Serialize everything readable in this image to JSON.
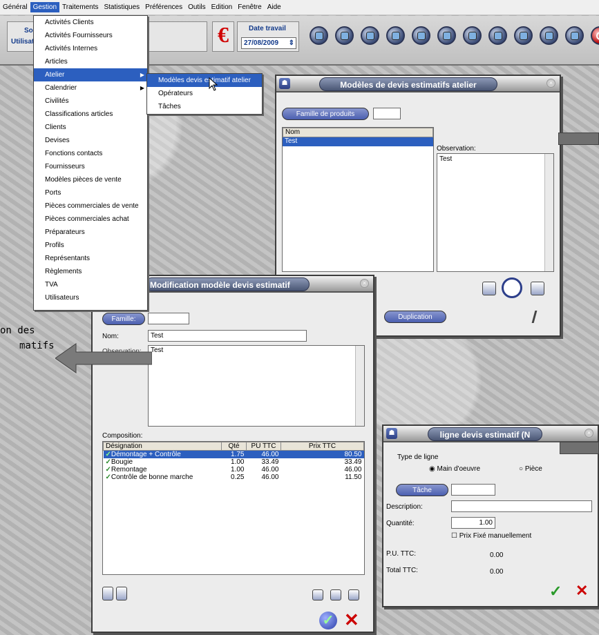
{
  "menubar": {
    "items": [
      "Général",
      "Gestion",
      "Traitements",
      "Statistiques",
      "Préférences",
      "Outils",
      "Edition",
      "Fenêtre",
      "Aide"
    ]
  },
  "toolbar": {
    "societe_label": "Socié",
    "utilisateur_label": "Utilisat",
    "euro": "€",
    "date_label": "Date travail",
    "date_value": "27/08/2009"
  },
  "gestion_menu": {
    "items": [
      "Activités Clients",
      "Activités Fournisseurs",
      "Activités Internes",
      "Articles",
      "Atelier",
      "Calendrier",
      "Civilités",
      "Classifications articles",
      "Clients",
      "Devises",
      "Fonctions contacts",
      "Fournisseurs",
      "Modèles pièces de vente",
      "Ports",
      "Pièces commerciales de vente",
      "Pièces commerciales achat",
      "Préparateurs",
      "Profils",
      "Représentants",
      "Règlements",
      "TVA",
      "Utilisateurs"
    ],
    "selected": "Atelier"
  },
  "atelier_submenu": {
    "items": [
      "Modèles devis estimatif atelier",
      "Opérateurs",
      "Tâches"
    ],
    "selected": "Modèles devis estimatif atelier"
  },
  "models_window": {
    "title": "Modèles de devis estimatifs atelier",
    "famille_button": "Famille de produits",
    "famille_value": "",
    "list_header": "Nom",
    "list_rows": [
      "Test"
    ],
    "observation_label": "Observation:",
    "observation_value": "Test",
    "duplication_button": "Duplication"
  },
  "modif_window": {
    "title": "Modification modèle devis estimatif",
    "famille_button": "Famille:",
    "famille_value": "",
    "nom_label": "Nom:",
    "nom_value": "Test",
    "observation_label": "Observation:",
    "observation_value": "Test",
    "composition_label": "Composition:",
    "columns": [
      "Désignation",
      "Qté",
      "PU TTC",
      "Prix TTC"
    ],
    "rows": [
      {
        "designation": "Démontage + Contrôle",
        "qte": "1.75",
        "pu": "46.00",
        "prix": "80.50"
      },
      {
        "designation": "Bougie",
        "qte": "1.00",
        "pu": "33.49",
        "prix": "33.49"
      },
      {
        "designation": "Remontage",
        "qte": "1.00",
        "pu": "46.00",
        "prix": "46.00"
      },
      {
        "designation": "Contrôle de bonne marche",
        "qte": "0.25",
        "pu": "46.00",
        "prix": "11.50"
      }
    ]
  },
  "ligne_window": {
    "title": "ligne devis estimatif (N",
    "type_label": "Type de ligne",
    "radio_main": "Main d'oeuvre",
    "radio_piece": "Pièce",
    "tache_button": "Tâche",
    "tache_value": "",
    "description_label": "Description:",
    "description_value": "",
    "quantite_label": "Quantité:",
    "quantite_value": "1.00",
    "prix_fixe_label": "Prix Fixé manuellement",
    "pu_label": "P.U. TTC:",
    "pu_value": "0.00",
    "total_label": "Total TTC:",
    "total_value": "0.00"
  },
  "callout": {
    "line1": "on des",
    "line2": "matifs"
  },
  "colors": {
    "menu_selection": "#2c5fbf",
    "title_pill": "#4a5674",
    "euro_red": "#d00000",
    "check_green": "#2a8a2a",
    "cross_red": "#cc0000"
  }
}
